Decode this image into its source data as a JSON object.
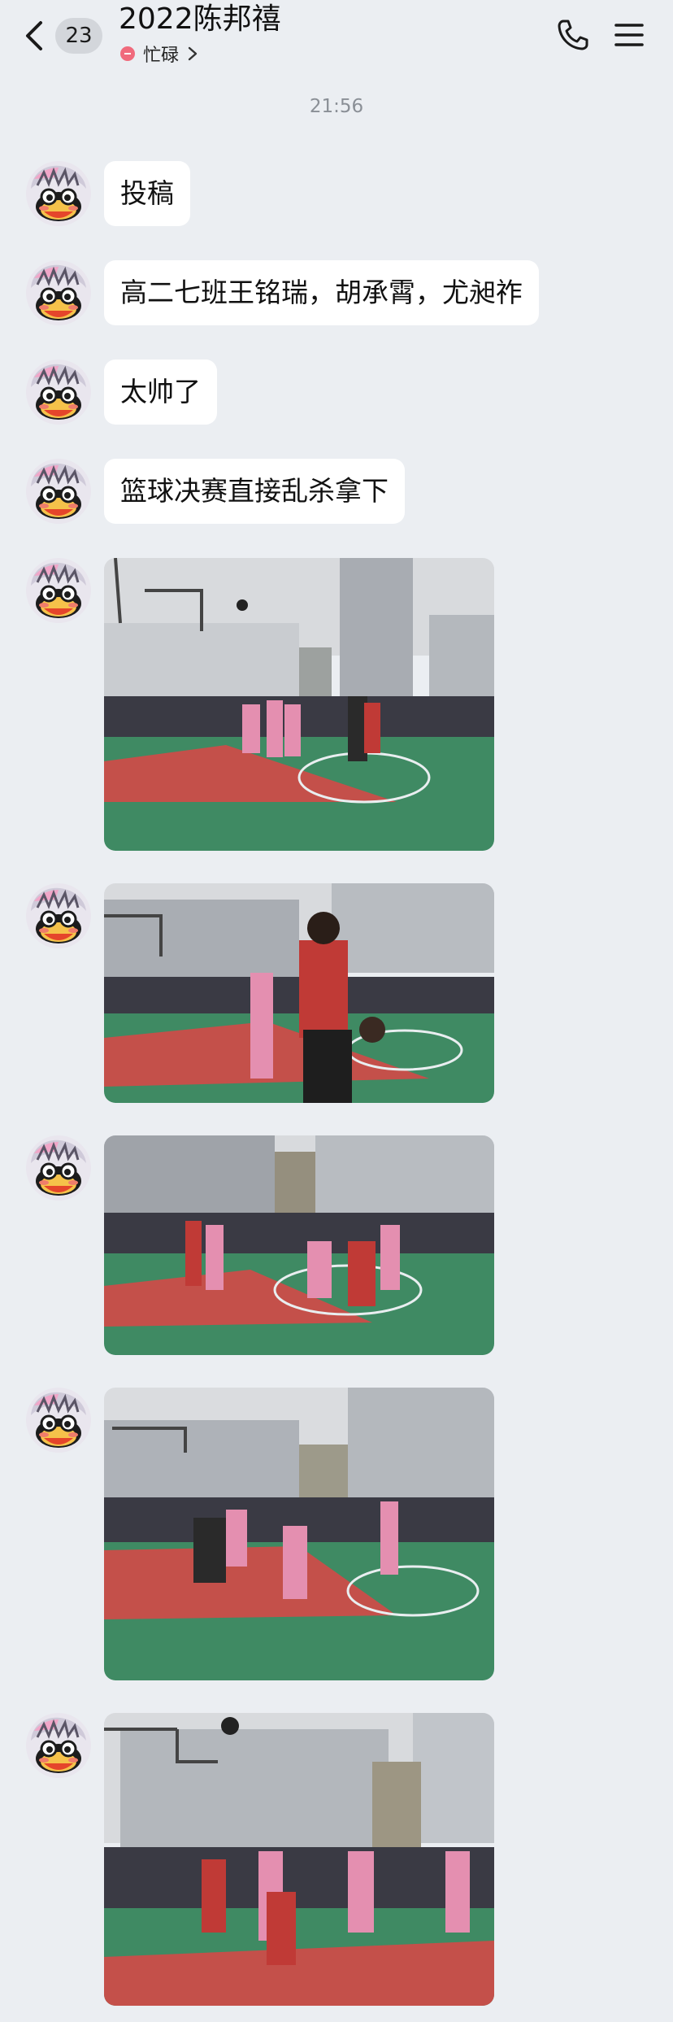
{
  "header": {
    "unread_count": "23",
    "title": "2022陈邦禧",
    "status": "忙碌"
  },
  "timestamp": "21:56",
  "messages": [
    {
      "type": "text",
      "text": "投稿"
    },
    {
      "type": "text",
      "text": "高二七班王铭瑞，胡承霄，尤昶祚"
    },
    {
      "type": "text",
      "text": "太帅了"
    },
    {
      "type": "text",
      "text": "篮球决赛直接乱杀拿下"
    },
    {
      "type": "image",
      "description": "basketball game photo 1"
    },
    {
      "type": "image",
      "description": "basketball game photo 2"
    },
    {
      "type": "image",
      "description": "basketball game photo 3"
    },
    {
      "type": "image",
      "description": "basketball game photo 4"
    },
    {
      "type": "image",
      "description": "basketball game photo 5"
    }
  ],
  "colors": {
    "background": "#ebeef2",
    "bubble": "#ffffff",
    "status_dot": "#f06a7c",
    "court_green": "#3f8a63",
    "court_red": "#c4504a"
  }
}
